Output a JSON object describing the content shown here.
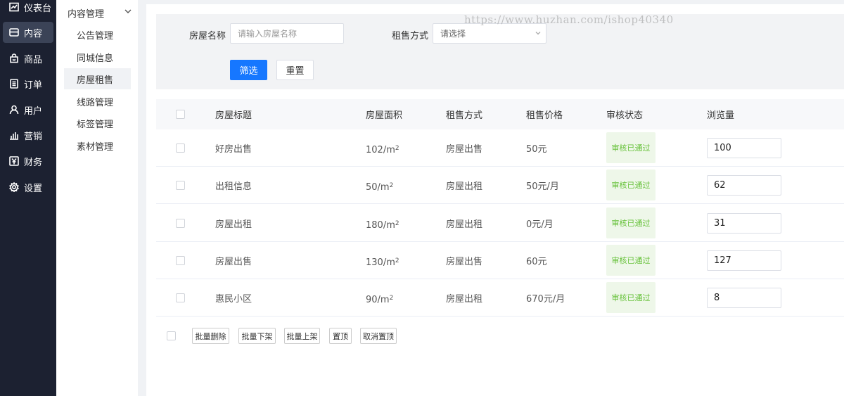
{
  "nav": {
    "items": [
      {
        "label": "仪表台",
        "icon": "chart-line-icon"
      },
      {
        "label": "内容",
        "icon": "inbox-icon"
      },
      {
        "label": "商品",
        "icon": "bag-icon"
      },
      {
        "label": "订单",
        "icon": "list-icon"
      },
      {
        "label": "用户",
        "icon": "user-icon"
      },
      {
        "label": "营销",
        "icon": "bar-chart-icon"
      },
      {
        "label": "财务",
        "icon": "yen-icon"
      },
      {
        "label": "设置",
        "icon": "gear-icon"
      }
    ],
    "active_index": 1
  },
  "submenu": {
    "title": "内容管理",
    "items": [
      "公告管理",
      "同城信息",
      "房屋租售",
      "线路管理",
      "标签管理",
      "素材管理"
    ],
    "active_index": 2
  },
  "filter": {
    "name_label": "房屋名称",
    "name_placeholder": "请输入房屋名称",
    "mode_label": "租售方式",
    "mode_value": "请选择",
    "submit_label": "筛选",
    "reset_label": "重置"
  },
  "watermark": "https://www.huzhan.com/ishop40340",
  "table": {
    "columns": [
      "房屋标题",
      "房屋面积",
      "租售方式",
      "租售价格",
      "审核状态",
      "浏览量"
    ],
    "area_unit": "/m",
    "area_exp": "2",
    "rows": [
      {
        "title": "好房出售",
        "area": "102",
        "mode": "房屋出售",
        "price": "50元",
        "status": "审核已通过",
        "views": "100"
      },
      {
        "title": "出租信息",
        "area": "50",
        "mode": "房屋出租",
        "price": "50元/月",
        "status": "审核已通过",
        "views": "62"
      },
      {
        "title": "房屋出租",
        "area": "180",
        "mode": "房屋出租",
        "price": "0元/月",
        "status": "审核已通过",
        "views": "31"
      },
      {
        "title": "房屋出售",
        "area": "130",
        "mode": "房屋出售",
        "price": "60元",
        "status": "审核已通过",
        "views": "127"
      },
      {
        "title": "惠民小区",
        "area": "90",
        "mode": "房屋出租",
        "price": "670元/月",
        "status": "审核已通过",
        "views": "8"
      }
    ]
  },
  "bulk_actions": [
    "批量删除",
    "批量下架",
    "批量上架",
    "置顶",
    "取消置顶"
  ],
  "colors": {
    "primary": "#1677ff",
    "nav_bg": "#1c2131",
    "status_green": "#67c23a"
  }
}
